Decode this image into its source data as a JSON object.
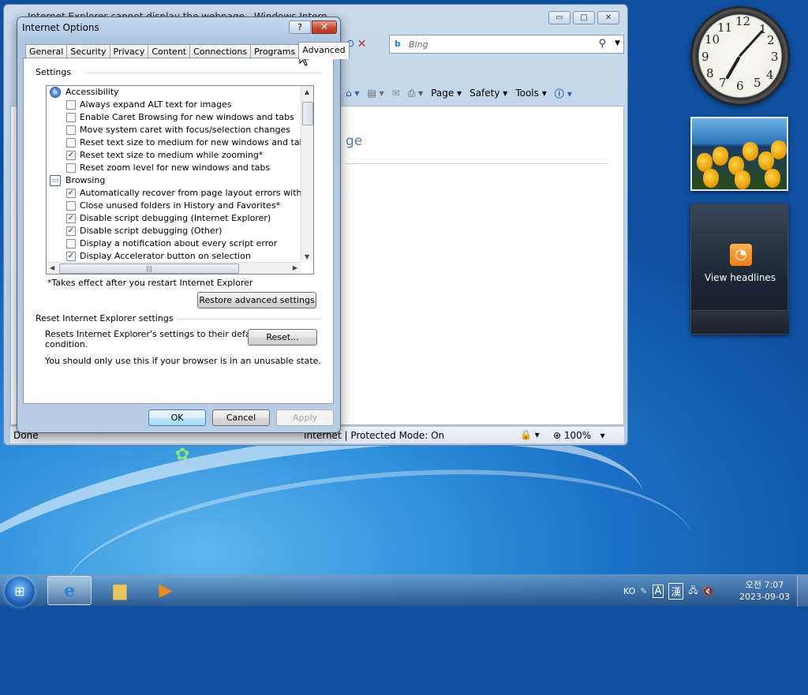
{
  "browser": {
    "title": "Internet Explorer cannot display the webpage - Windows Internet Explorer",
    "search_placeholder": "Bing",
    "command_bar": [
      "Page",
      "Safety",
      "Tools"
    ],
    "page_heading_fragment": "ge",
    "status_left": "Done",
    "status_zone": "Internet | Protected Mode: On",
    "zoom": "100%"
  },
  "dialog": {
    "title": "Internet Options",
    "help_button": "?",
    "close_button": "✕",
    "tabs": [
      "General",
      "Security",
      "Privacy",
      "Content",
      "Connections",
      "Programs",
      "Advanced"
    ],
    "active_tab": "Advanced",
    "settings_group": "Settings",
    "tree": [
      {
        "type": "category",
        "label": "Accessibility"
      },
      {
        "type": "option",
        "label": "Always expand ALT text for images",
        "checked": false
      },
      {
        "type": "option",
        "label": "Enable Caret Browsing for new windows and tabs",
        "checked": false
      },
      {
        "type": "option",
        "label": "Move system caret with focus/selection changes",
        "checked": false
      },
      {
        "type": "option",
        "label": "Reset text size to medium for new windows and tabs",
        "checked": false
      },
      {
        "type": "option",
        "label": "Reset text size to medium while zooming*",
        "checked": true
      },
      {
        "type": "option",
        "label": "Reset zoom level for new windows and tabs",
        "checked": false
      },
      {
        "type": "category",
        "label": "Browsing"
      },
      {
        "type": "option",
        "label": "Automatically recover from page layout errors with Compa",
        "checked": true
      },
      {
        "type": "option",
        "label": "Close unused folders in History and Favorites*",
        "checked": false
      },
      {
        "type": "option",
        "label": "Disable script debugging (Internet Explorer)",
        "checked": true
      },
      {
        "type": "option",
        "label": "Disable script debugging (Other)",
        "checked": true
      },
      {
        "type": "option",
        "label": "Display a notification about every script error",
        "checked": false
      },
      {
        "type": "option",
        "label": "Display Accelerator button on selection",
        "checked": true
      }
    ],
    "restart_note": "*Takes effect after you restart Internet Explorer",
    "restore_button": "Restore advanced settings",
    "reset_group": "Reset Internet Explorer settings",
    "reset_desc_1": "Resets Internet Explorer's settings to their default",
    "reset_desc_2": "condition.",
    "reset_button": "Reset...",
    "reset_warning": "You should only use this if your browser is in an unusable state.",
    "ok": "OK",
    "cancel": "Cancel",
    "apply": "Apply"
  },
  "gadgets": {
    "rss_label": "View headlines"
  },
  "taskbar": {
    "lang": "KO",
    "ime_a": "A",
    "ime_han": "漢",
    "time": "오전 7:07",
    "date": "2023-09-03"
  }
}
